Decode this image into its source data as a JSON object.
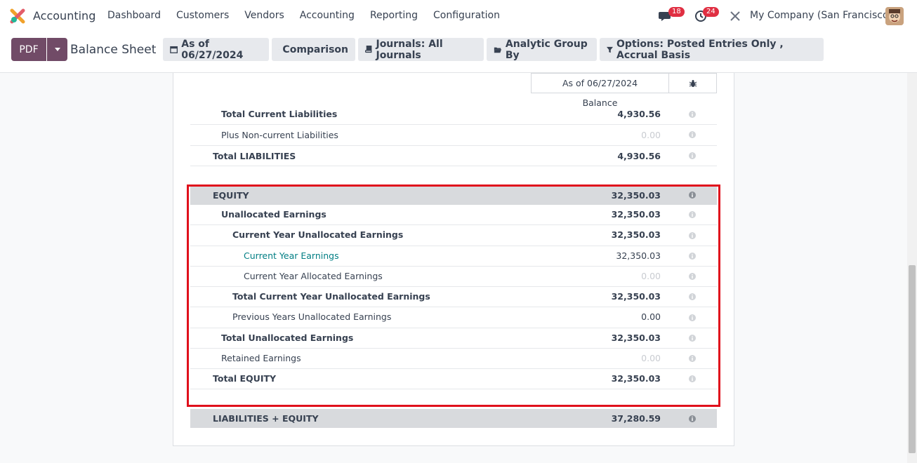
{
  "navbar": {
    "app_name": "Accounting",
    "menu": [
      "Dashboard",
      "Customers",
      "Vendors",
      "Accounting",
      "Reporting",
      "Configuration"
    ],
    "messages_count": "18",
    "activities_count": "24",
    "company": "My Company (San Francisco)",
    "colors": {
      "badge": "#e02f42",
      "brand": "#714b67"
    }
  },
  "controlbar": {
    "pdf_label": "PDF",
    "title": "Balance Sheet",
    "filters": [
      {
        "icon": "calendar-icon",
        "label": "As of 06/27/2024"
      },
      {
        "icon": "bar-chart-icon",
        "label": "Comparison"
      },
      {
        "icon": "book-icon",
        "label": "Journals: All Journals"
      },
      {
        "icon": "folder-open-icon",
        "label": "Analytic Group By"
      },
      {
        "icon": "filter-icon",
        "label": "Options: Posted Entries Only , Accrual Basis"
      }
    ]
  },
  "report": {
    "column_header": "As of 06/27/2024",
    "column_sub": "Balance",
    "rows": [
      {
        "label": "Total Current Liabilities",
        "value": "4,930.56"
      },
      {
        "label": "Plus Non-current Liabilities",
        "value": "0.00"
      },
      {
        "label": "Total LIABILITIES",
        "value": "4,930.56"
      },
      {
        "label": "EQUITY",
        "value": "32,350.03"
      },
      {
        "label": "Unallocated Earnings",
        "value": "32,350.03"
      },
      {
        "label": "Current Year Unallocated Earnings",
        "value": "32,350.03"
      },
      {
        "label": "Current Year Earnings",
        "value": "32,350.03"
      },
      {
        "label": "Current Year Allocated Earnings",
        "value": "0.00"
      },
      {
        "label": "Total Current Year Unallocated Earnings",
        "value": "32,350.03"
      },
      {
        "label": "Previous Years Unallocated Earnings",
        "value": "0.00"
      },
      {
        "label": "Total Unallocated Earnings",
        "value": "32,350.03"
      },
      {
        "label": "Retained Earnings",
        "value": "0.00"
      },
      {
        "label": "Total EQUITY",
        "value": "32,350.03"
      },
      {
        "label": "LIABILITIES + EQUITY",
        "value": "37,280.59"
      }
    ]
  }
}
